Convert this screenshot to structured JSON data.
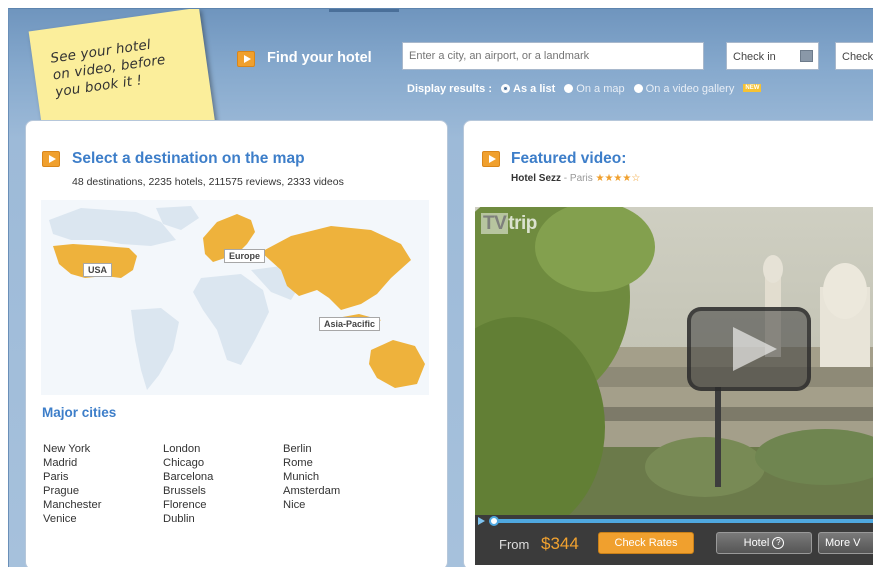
{
  "sticky": {
    "lines": [
      "See your hotel",
      "on video, before",
      "you book it !"
    ]
  },
  "search": {
    "title": "Find your hotel",
    "placeholder": "Enter a city, an airport, or a landmark",
    "checkin": "Check in",
    "checkout": "Check o",
    "display_label": "Display results :",
    "options": [
      "As a list",
      "On a map",
      "On a video gallery"
    ],
    "selected": "As a list",
    "new_badge": "NEW"
  },
  "destinations": {
    "title": "Select a destination on the map",
    "stats": "48 destinations, 2235 hotels, 211575 reviews, 2333 videos",
    "regions": [
      "USA",
      "Europe",
      "Asia-Pacific"
    ]
  },
  "cities": {
    "title": "Major cities",
    "col1": [
      "New York",
      "Madrid",
      "Paris",
      "Prague",
      "Manchester",
      "Venice"
    ],
    "col2": [
      "London",
      "Chicago",
      "Barcelona",
      "Brussels",
      "Florence",
      "Dublin"
    ],
    "col3": [
      "Berlin",
      "Rome",
      "Munich",
      "Amsterdam",
      "Nice"
    ]
  },
  "featured": {
    "title": "Featured video:",
    "hotel": "Hotel Sezz",
    "separator": " - ",
    "city": "Paris",
    "stars": "★★★★☆",
    "logo_tv": "TV",
    "logo_rest": "trip",
    "from_label": "From",
    "price": "$344",
    "check_rates": "Check Rates",
    "hotel_btn": "Hotel",
    "more_btn": "More V"
  },
  "colors": {
    "accent_blue": "#3d7ec9",
    "orange": "#f0a02e",
    "bg_blue": "#86a9cd"
  }
}
